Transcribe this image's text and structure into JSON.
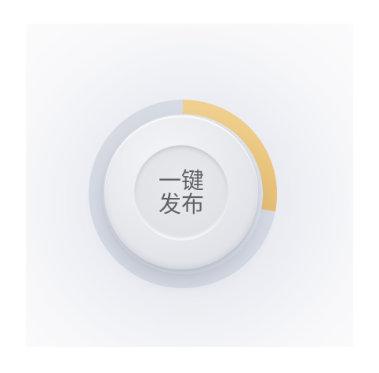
{
  "button": {
    "line1": "一键",
    "line2": "发布"
  },
  "progress": {
    "fraction": 0.28,
    "track_color": "#d6dae3",
    "fill_color": "#ecc884"
  }
}
